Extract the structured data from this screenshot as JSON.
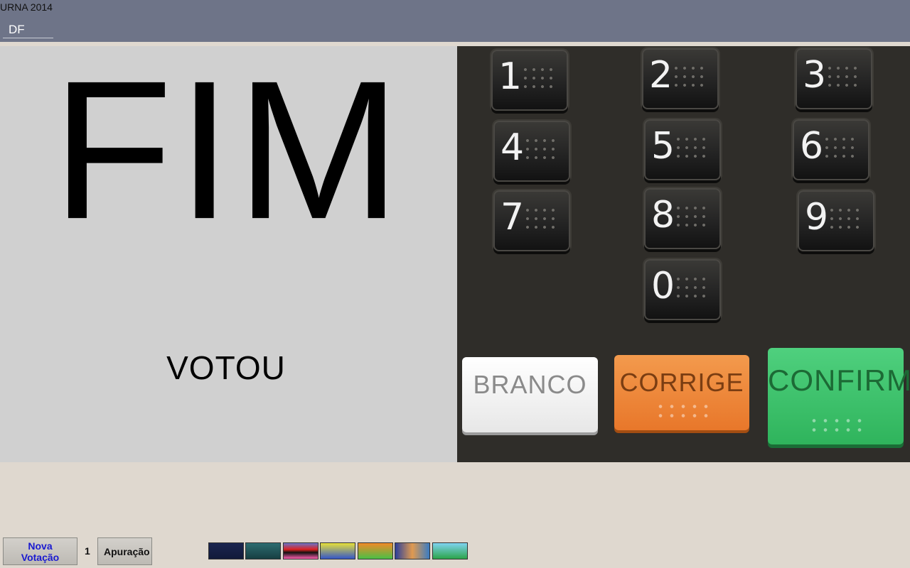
{
  "header": {
    "app_title": "URNA 2014",
    "state_value": "DF"
  },
  "screen": {
    "big_text": "FIM",
    "status_text": "VOTOU"
  },
  "keypad": {
    "keys": [
      "1",
      "2",
      "3",
      "4",
      "5",
      "6",
      "7",
      "8",
      "9",
      "0"
    ],
    "branco_label": "BRANCO",
    "corrige_label": "CORRIGE",
    "confirma_label": "CONFIRMA"
  },
  "footer": {
    "nova_votacao_label": "Nova Votação",
    "vote_count": "1",
    "apuracao_label": "Apuração"
  }
}
